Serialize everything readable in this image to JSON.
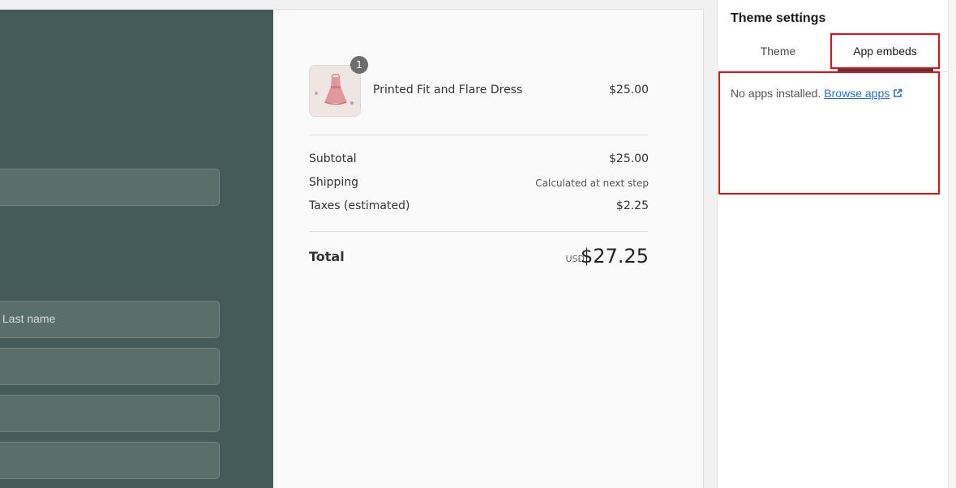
{
  "preview": {
    "fields": [
      {
        "placeholder": ""
      },
      {
        "placeholder": "Last name"
      },
      {
        "placeholder": ""
      },
      {
        "placeholder": ""
      },
      {
        "placeholder": ""
      }
    ],
    "order_summary": {
      "item": {
        "name": "Printed Fit and Flare Dress",
        "price": "$25.00",
        "quantity": "1",
        "thumbnail_icon": "dress-thumbnail"
      },
      "subtotal_label": "Subtotal",
      "subtotal_value": "$25.00",
      "shipping_label": "Shipping",
      "shipping_value": "Calculated at next step",
      "taxes_label": "Taxes (estimated)",
      "taxes_value": "$2.25",
      "total_label": "Total",
      "total_currency": "USD",
      "total_value": "$27.25"
    }
  },
  "settings": {
    "title": "Theme settings",
    "tabs": [
      {
        "label": "Theme",
        "active": false
      },
      {
        "label": "App embeds",
        "active": true
      }
    ],
    "empty_message": "No apps installed.",
    "browse_link": "Browse apps",
    "browse_icon": "external-link-icon"
  },
  "colors": {
    "checkout_dark": "#445b59",
    "highlight": "#d5151a",
    "link": "#2c6ecb"
  }
}
